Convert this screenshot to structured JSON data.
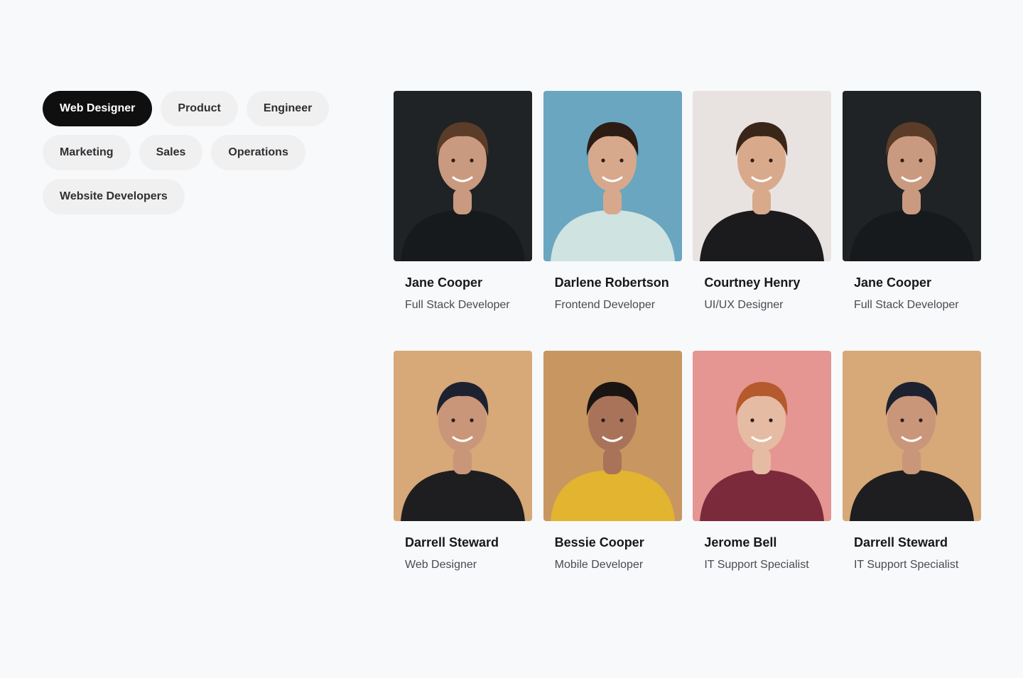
{
  "filters": {
    "rows": [
      [
        {
          "label": "Web Designer",
          "active": true
        },
        {
          "label": "Product"
        },
        {
          "label": "Engineer"
        }
      ],
      [
        {
          "label": "Marketing"
        },
        {
          "label": "Sales"
        },
        {
          "label": "Operations"
        }
      ],
      [
        {
          "label": "Website Developers"
        }
      ]
    ]
  },
  "team": [
    {
      "name": "Jane Cooper",
      "role": "Full Stack Developer",
      "photo_bg": "#1f2326",
      "shirt": "#161a1d",
      "skin": "#c99a7f",
      "hair": "#5a3c28"
    },
    {
      "name": "Darlene Robertson",
      "role": "Frontend Developer",
      "photo_bg": "#6aa6bf",
      "shirt": "#cfe3e0",
      "skin": "#d7a88c",
      "hair": "#2c1c14"
    },
    {
      "name": "Courtney Henry",
      "role": "UI/UX Designer",
      "photo_bg": "#e8e3e1",
      "shirt": "#1b1b1d",
      "skin": "#d9a98b",
      "hair": "#3a2618"
    },
    {
      "name": "Jane Cooper",
      "role": "Full Stack Developer",
      "photo_bg": "#1f2326",
      "shirt": "#161a1d",
      "skin": "#c99a7f",
      "hair": "#5a3c28"
    },
    {
      "name": "Darrell Steward",
      "role": "Web Designer",
      "photo_bg": "#d7a878",
      "shirt": "#1e1e20",
      "skin": "#c9967a",
      "hair": "#1d2230"
    },
    {
      "name": "Bessie Cooper",
      "role": "Mobile Developer",
      "photo_bg": "#c89660",
      "shirt": "#e2b430",
      "skin": "#a9735a",
      "hair": "#1a1512"
    },
    {
      "name": "Jerome Bell",
      "role": "IT Support Specialist",
      "photo_bg": "#e59592",
      "shirt": "#7a2a3a",
      "skin": "#e6bba3",
      "hair": "#b45a2c"
    },
    {
      "name": "Darrell Steward",
      "role": "IT Support Specialist",
      "photo_bg": "#d7a878",
      "shirt": "#1e1e20",
      "skin": "#c9967a",
      "hair": "#1d2230"
    }
  ]
}
